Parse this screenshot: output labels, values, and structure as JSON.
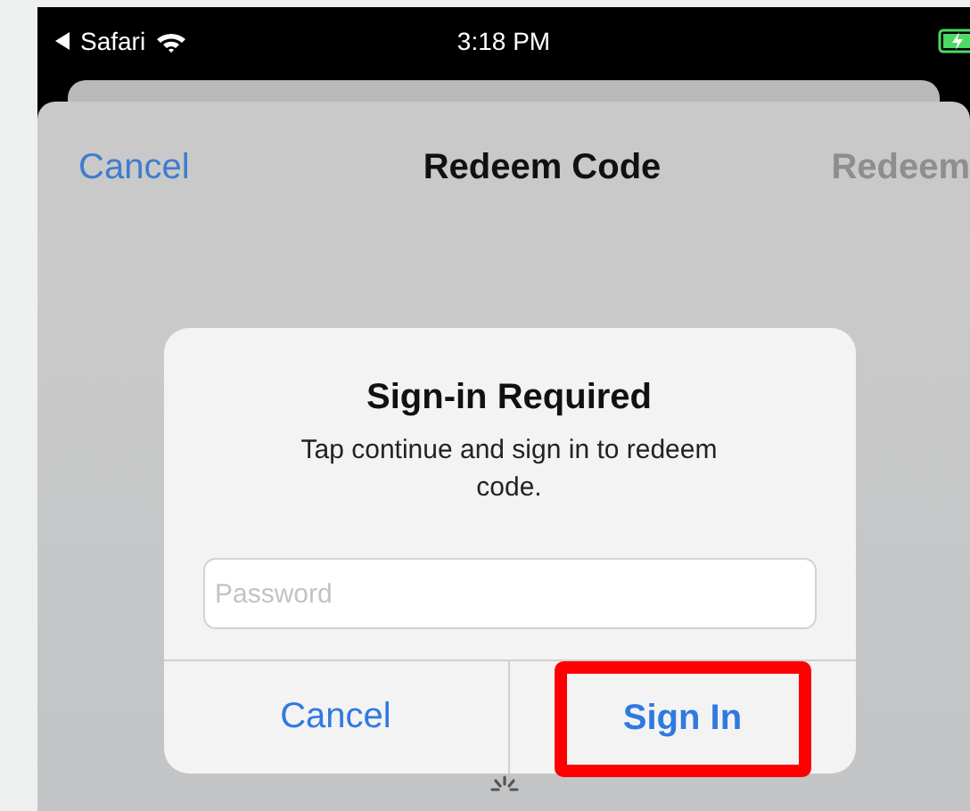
{
  "status_bar": {
    "back_app": "Safari",
    "time": "3:18 PM",
    "charging": true
  },
  "nav_bar": {
    "cancel": "Cancel",
    "title": "Redeem Code",
    "redeem": {
      "label": "Redeem",
      "disabled": true
    }
  },
  "alert": {
    "title": "Sign-in Required",
    "message": "Tap continue and sign in to redeem code.",
    "password": {
      "placeholder": "Password"
    },
    "actions": [
      {
        "label": "Cancel",
        "highlighted": false
      },
      {
        "label": "Sign In",
        "highlighted": true
      }
    ]
  },
  "loading": true
}
